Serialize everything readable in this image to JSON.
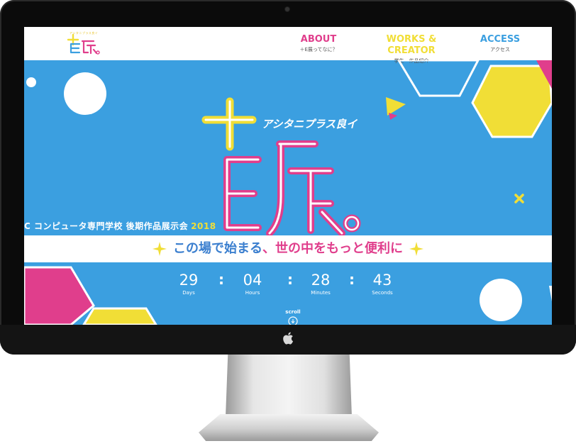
{
  "header": {
    "logo_text": "E展",
    "logo_sub": "アシタニプラス良イ",
    "nav": [
      {
        "label": "ABOUT",
        "sub": "＋E展ってなに？"
      },
      {
        "label": "WORKS & CREATOR",
        "sub": "学生・作品紹介"
      },
      {
        "label": "ACCESS",
        "sub": "アクセス"
      }
    ]
  },
  "hero": {
    "logo_kana": "アシタニプラス良イ",
    "logo_main": "E展",
    "school_line": "C コンピュータ専門学校 後期作品展示会",
    "year": "2018",
    "tagline_part1": "この場で始まる",
    "tagline_comma": "、",
    "tagline_part2": "世の中をもっと便利に"
  },
  "countdown": [
    {
      "value": "29",
      "unit": "Days"
    },
    {
      "value": "04",
      "unit": "Hours"
    },
    {
      "value": "28",
      "unit": "Minutes"
    },
    {
      "value": "43",
      "unit": "Seconds"
    }
  ],
  "countdown_separator": ":",
  "scroll_label": "scroll",
  "colors": {
    "sky_blue": "#3b9fe0",
    "pink": "#e03e8c",
    "yellow": "#f1de36",
    "white": "#ffffff",
    "bezel": "#0b0b0b"
  }
}
